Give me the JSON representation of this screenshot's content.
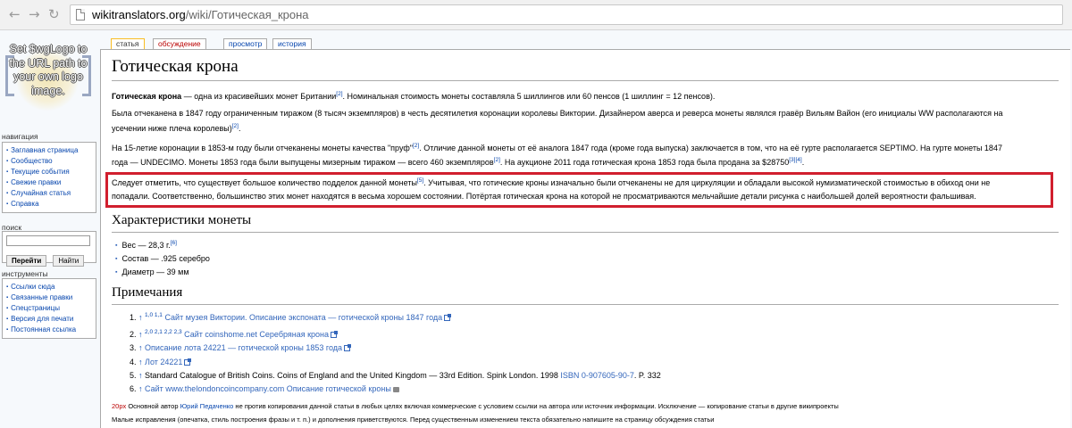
{
  "browser": {
    "url_host": "wikitranslators.org",
    "url_path": "/wiki/Готическая_крона"
  },
  "sidebar": {
    "logo_text": "Set $wgLogo to the URL path to your own logo image.",
    "navigation": {
      "heading": "навигация",
      "items": [
        "Заглавная страница",
        "Сообщество",
        "Текущие события",
        "Свежие правки",
        "Случайная статья",
        "Справка"
      ]
    },
    "search": {
      "heading": "поиск",
      "go_label": "Перейти",
      "find_label": "Найти",
      "value": ""
    },
    "tools": {
      "heading": "инструменты",
      "items": [
        "Ссылки сюда",
        "Связанные правки",
        "Спецстраницы",
        "Версия для печати",
        "Постоянная ссылка"
      ]
    }
  },
  "tabs": [
    {
      "label": "статья",
      "state": "selected"
    },
    {
      "label": "обсуждение",
      "state": "new"
    },
    {
      "label": "просмотр",
      "state": "normal"
    },
    {
      "label": "история",
      "state": "normal"
    }
  ],
  "article": {
    "title": "Готическая крона",
    "p1_bold": "Готическая крона",
    "p1_text": " — одна из красивейших монет Британии",
    "p1_ref": "[2]",
    "p1_text2": ". Номинальная стоимость монеты составляла 5 шиллингов или 60 пенсов (1 шиллинг = 12 пенсов).",
    "p2_line1": "Была отчеканена в 1847 году ограниченным тиражом (8 тысяч экземпляров) в честь десятилетия коронации королевы Виктории. Дизайнером аверса и реверса монеты являлся гравёр Вильям Вайон (его инициалы WW располагаются на",
    "p2_line2": "усечении ниже плеча королевы)",
    "p2_ref": "[2]",
    "p2_end": ".",
    "p3_line1a": "На 15-летие коронации в 1853-м году были отчеканены монеты качества \"пруф\"",
    "p3_ref1": "[2]",
    "p3_line1b": ". Отличие данной монеты от её аналога 1847 года (кроме года выпуска) заключается в том, что на её гурте располагается SEPTIMO. На гурте монеты 1847",
    "p3_line2a": "года — UNDECIMO. Монеты 1853 года были выпущены мизерным тиражом — всего 460 экземпляров",
    "p3_ref2": "[2]",
    "p3_line2b": ". На аукционе 2011 года готическая крона 1853 года была продана за $28750",
    "p3_ref3": "[3][4]",
    "p3_end": ".",
    "p4_line1a": "Следует отметить, что существует большое количество подделок данной монеты",
    "p4_ref": "[5]",
    "p4_line1b": ". Учитывая, что готические кроны изначально были отчеканены не для циркуляции и обладали высокой нумизматической стоимостью в обиход они не",
    "p4_line2": "попадали. Соответственно, большинство этих монет находятся в весьма хорошем состоянии. Потёртая готическая крона на которой не просматриваются мельчайшие детали рисунка с наибольшей долей вероятности фальшивая.",
    "h_characteristics": "Характеристики монеты",
    "characteristics": [
      {
        "text": "Вес — 28,3 г.",
        "ref": "[6]"
      },
      {
        "text": "Состав — .925 серебро",
        "ref": ""
      },
      {
        "text": "Диаметр — 39 мм",
        "ref": ""
      }
    ],
    "h_notes": "Примечания",
    "notes": [
      {
        "num": "1.",
        "up": "↑",
        "backrefs": "1,0 1,1",
        "link": "Сайт музея Виктории. Описание экспоната — готической кроны 1847 года",
        "plain": ""
      },
      {
        "num": "2.",
        "up": "↑",
        "backrefs": "2,0 2,1 2,2 2,3",
        "link": "Сайт coinshome.net Серебряная крона",
        "plain": ""
      },
      {
        "num": "3.",
        "up": "↑",
        "backrefs": "",
        "link": "Описание лота 24221 — готической кроны 1853 года",
        "plain": ""
      },
      {
        "num": "4.",
        "up": "↑",
        "backrefs": "",
        "link": "Лот 24221",
        "plain": ""
      },
      {
        "num": "5.",
        "up": "↑",
        "backrefs": "",
        "link": "",
        "plain": "Standard Catalogue of British Coins. Coins of England and the United Kingdom — 33rd Edition. Spink London. 1998",
        "isbn": "ISBN 0-907605-90-7",
        "tail": ". P. 332"
      },
      {
        "num": "6.",
        "up": "↑",
        "backrefs": "",
        "link": "Сайт www.thelondoncoincompany.com Описание готической кроны",
        "plain": ""
      }
    ],
    "footer1_new": "20px",
    "footer1_a": " Основной автор ",
    "footer1_author": "Юрий Педаченко",
    "footer1_b": " не против копирования данной статьи в любых целях включая коммерческие с условием ссылки на автора или источник информации. Исключение — копирование статьи в другие википроекты",
    "footer2": "Малые исправления (опечатка, стиль построения фразы и т. п.) и дополнения приветствуются. Перед существенным изменением текста обязательно напишите на страницу обсуждения статьи"
  }
}
